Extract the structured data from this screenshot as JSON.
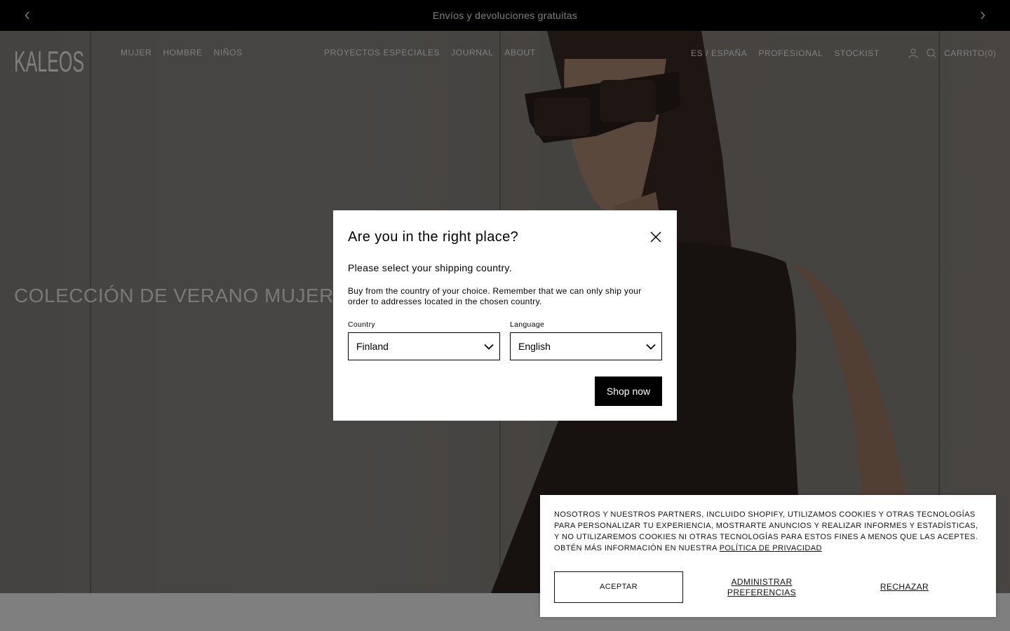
{
  "announcement": {
    "text": "Envíos y devoluciones gratuitas"
  },
  "header": {
    "logo": "KALEOS",
    "nav_left": [
      "MUJER",
      "HOMBRE",
      "NIÑOS"
    ],
    "nav_center": [
      "PROYECTOS ESPECIALES",
      "JOURNAL",
      "ABOUT"
    ],
    "nav_right": [
      "ES / ESPAÑA",
      "PROFESIONAL",
      "STOCKIST"
    ],
    "cart_label": "CARRITO(0)"
  },
  "hero": {
    "title": "COLECCIÓN DE VERANO MUJER"
  },
  "modal": {
    "title": "Are you in the right place?",
    "subtitle": "Please select your shipping country.",
    "description": "Buy from the country of your choice. Remember that we can only ship your order to addresses located in the chosen country.",
    "country_label": "Country",
    "country_value": "Finland",
    "language_label": "Language",
    "language_value": "English",
    "submit_label": "Shop now"
  },
  "cookie": {
    "text": "Nosotros y nuestros partners, incluido Shopify, utilizamos cookies y otras tecnologías para personalizar tu experiencia, mostrarte anuncios y realizar informes y estadísticas, y no utilizaremos cookies ni otras tecnologías para estos fines a menos que las aceptes. Obtén más información en nuestra",
    "link_text": "Política de privacidad",
    "accept_label": "ACEPTAR",
    "manage_label": "ADMINISTRAR PREFERENCIAS",
    "reject_label": "RECHAZAR"
  },
  "colors": {
    "overlay": "#000000",
    "button_bg": "#000000",
    "button_text": "#ffffff"
  }
}
